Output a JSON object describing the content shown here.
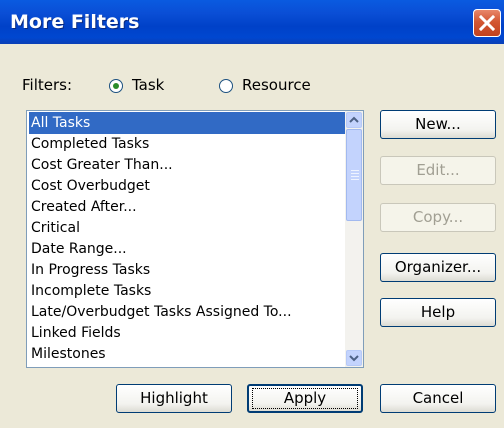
{
  "window": {
    "title": "More Filters"
  },
  "filters": {
    "label": "Filters:",
    "options": [
      {
        "label": "Task",
        "selected": true
      },
      {
        "label": "Resource",
        "selected": false
      }
    ]
  },
  "list": {
    "items": [
      "All Tasks",
      "Completed Tasks",
      "Cost Greater Than...",
      "Cost Overbudget",
      "Created After...",
      "Critical",
      "Date Range...",
      "In Progress Tasks",
      "Incomplete Tasks",
      "Late/Overbudget Tasks Assigned To...",
      "Linked Fields",
      "Milestones"
    ],
    "selected_index": 0
  },
  "side_buttons": [
    {
      "label": "New...",
      "enabled": true
    },
    {
      "label": "Edit...",
      "enabled": false
    },
    {
      "label": "Copy...",
      "enabled": false
    },
    {
      "label": "Organizer...",
      "enabled": true
    },
    {
      "label": "Help",
      "enabled": true
    }
  ],
  "bottom_buttons": [
    {
      "label": "Highlight"
    },
    {
      "label": "Apply",
      "default": true
    },
    {
      "label": "Cancel"
    }
  ],
  "colors": {
    "titlebar": "#0a4ed6",
    "dialog_bg": "#ece9d8",
    "selection": "#316ac5",
    "close_button": "#d35733"
  },
  "icons": {
    "close": "close-icon",
    "scroll_up": "chevron-up-icon",
    "scroll_down": "chevron-down-icon"
  }
}
